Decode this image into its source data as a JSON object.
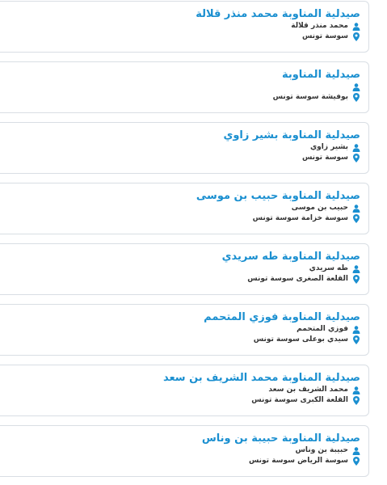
{
  "colors": {
    "title": "#1a8fd0",
    "icon": "#1a8fd0",
    "text": "#333333",
    "border": "#d9dee4"
  },
  "icons": {
    "person": "user-icon",
    "location": "map-pin-icon"
  },
  "pharmacies": [
    {
      "title": "صيدلية المناوبة محمد منذر قلالة",
      "owner": "محمد منذر قلالة",
      "address": "سوسة تونس"
    },
    {
      "title": "صيدلية المناوبة",
      "owner": "",
      "address": "بوفيشة سوسة تونس"
    },
    {
      "title": "صيدلية المناوبة بشير زاوي",
      "owner": "بشير زاوي",
      "address": "سوسة تونس"
    },
    {
      "title": "صيدلية المناوبة حبيب بن موسى",
      "owner": "حبيب بن موسى",
      "address": "سوسة خزامة سوسة تونس"
    },
    {
      "title": "صيدلية المناوبة طه سريدي",
      "owner": "طه سريدي",
      "address": "القلعة الصغرى سوسة تونس"
    },
    {
      "title": "صيدلية المناوبة فوزي المتحمم",
      "owner": "فوزي المتحمم",
      "address": "سيدي بوعلى سوسة تونس"
    },
    {
      "title": "صيدلية المناوبة محمد الشريف بن سعد",
      "owner": "محمد الشريف بن سعد",
      "address": "القلعة الكبرى سوسة تونس"
    },
    {
      "title": "صيدلية المناوبة حبيبة بن وناس",
      "owner": "حبيبة بن وناس",
      "address": "سوسة الرياض سوسة تونس"
    }
  ]
}
